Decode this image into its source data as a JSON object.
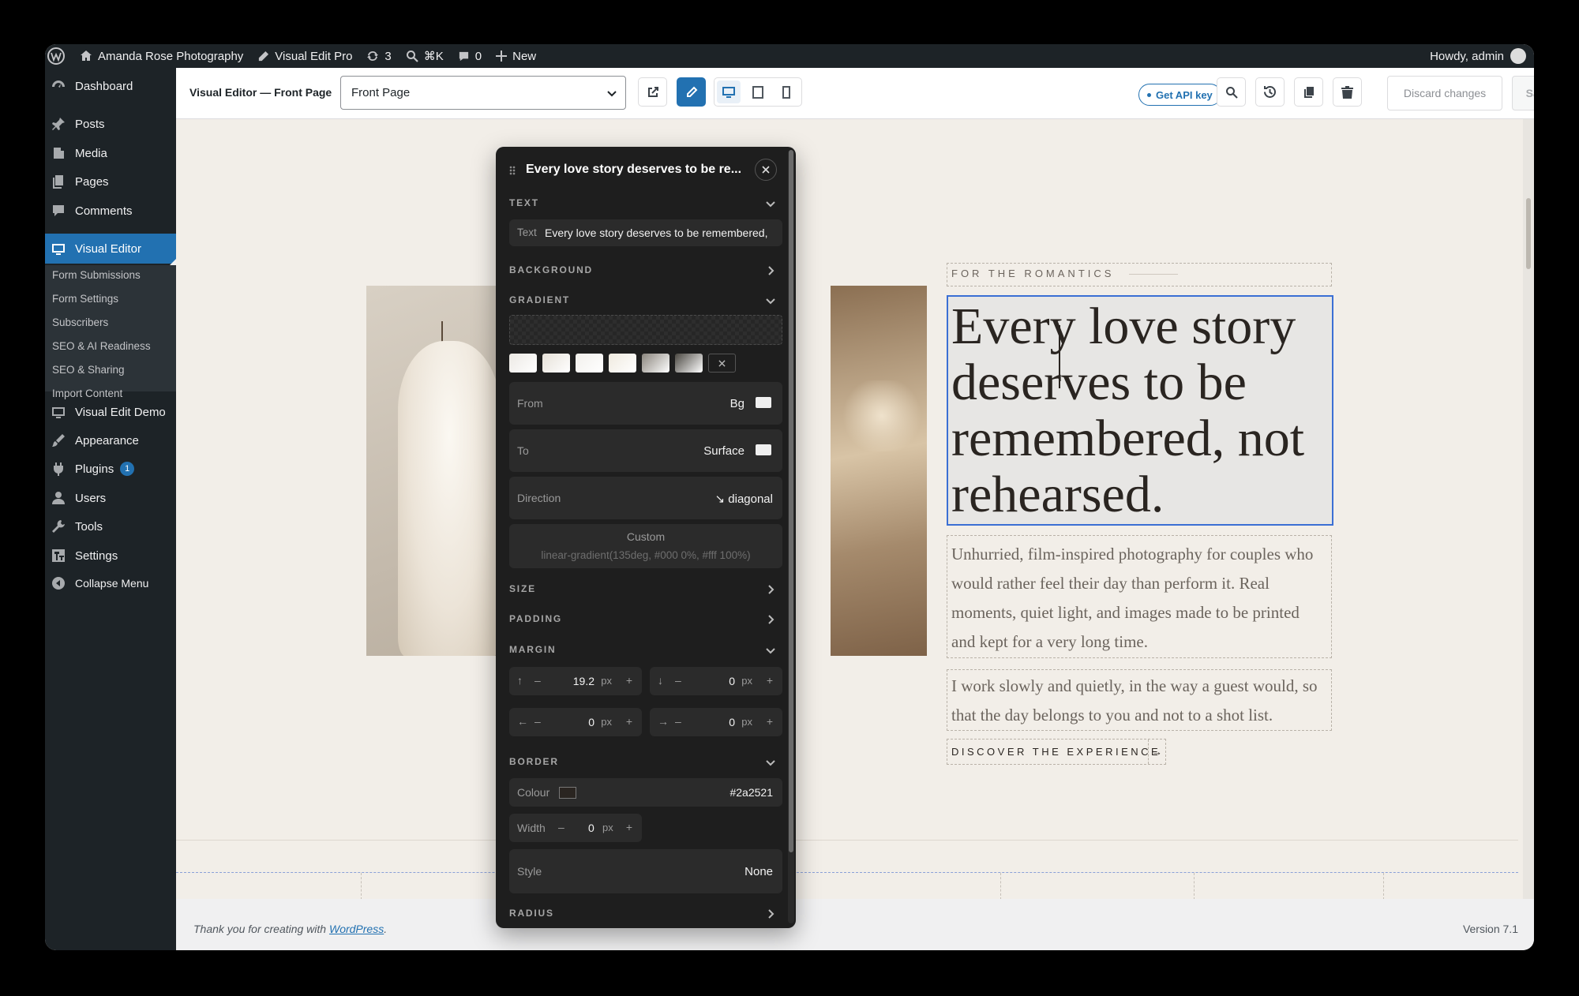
{
  "admin_bar": {
    "site_name": "Amanda Rose Photography",
    "plugin_name": "Visual Edit Pro",
    "updates_count": "3",
    "search_shortcut": "⌘K",
    "comments_count": "0",
    "new_label": "New",
    "howdy": "Howdy, admin"
  },
  "sidebar": {
    "items": [
      {
        "label": "Dashboard"
      },
      {
        "label": "Posts"
      },
      {
        "label": "Media"
      },
      {
        "label": "Pages"
      },
      {
        "label": "Comments"
      },
      {
        "label": "Visual Editor"
      },
      {
        "label": "Visual Edit Demo"
      },
      {
        "label": "Appearance"
      },
      {
        "label": "Plugins"
      },
      {
        "label": "Users"
      },
      {
        "label": "Tools"
      },
      {
        "label": "Settings"
      },
      {
        "label": "Collapse Menu"
      }
    ],
    "plugins_badge": "1",
    "submenu": [
      "Form Submissions",
      "Form Settings",
      "Subscribers",
      "SEO & AI Readiness",
      "SEO & Sharing",
      "Import Content"
    ]
  },
  "toolbar": {
    "title": "Visual Editor — Front Page",
    "page_select": "Front Page",
    "api_key_label": "Get API key",
    "discard_label": "Discard changes",
    "save_label": "Save",
    "accent": "#2271b1"
  },
  "panel": {
    "title": "Every love story deserves to be re...",
    "sections": {
      "text": "TEXT",
      "background": "BACKGROUND",
      "gradient": "GRADIENT",
      "size": "SIZE",
      "padding": "PADDING",
      "margin": "MARGIN",
      "border": "BORDER",
      "radius": "RADIUS"
    },
    "text_field": {
      "label": "Text",
      "value": "Every love story deserves to be remembered,"
    },
    "gradient": {
      "from_label": "From",
      "from_value": "Bg",
      "to_label": "To",
      "to_value": "Surface",
      "direction_label": "Direction",
      "direction_value": "↘ diagonal",
      "custom_label": "Custom",
      "custom_placeholder": "linear-gradient(135deg, #000 0%, #fff 100%)",
      "presets": [
        "#ece9e4",
        "#e6e1d8",
        "#f2f0ec",
        "#efeadf",
        "#8a857d",
        "#4a4741"
      ]
    },
    "margin": {
      "top": "19.2",
      "bottom": "0",
      "left": "0",
      "right": "0",
      "unit": "px"
    },
    "border": {
      "colour_label": "Colour",
      "colour_value": "#2a2521",
      "width_label": "Width",
      "width_value": "0",
      "width_unit": "px",
      "style_label": "Style",
      "style_value": "None"
    }
  },
  "page": {
    "eyebrow": "FOR THE ROMANTICS",
    "headline": "Every love story deserves to be remembered, not rehearsed.",
    "para1": "Unhurried, film-inspired photography for couples who would rather feel their day than perform it. Real moments, quiet light, and images made to be printed and kept for a very long time.",
    "para2": "I work slowly and quietly, in the way a guest would, so that the day belongs to you and not to a shot list.",
    "cta": "DISCOVER THE EXPERIENCE",
    "cta_arrow": "→"
  },
  "footer": {
    "thanks_prefix": "Thank you for creating with ",
    "thanks_link": "WordPress",
    "thanks_suffix": ".",
    "version": "Version 7.1"
  }
}
